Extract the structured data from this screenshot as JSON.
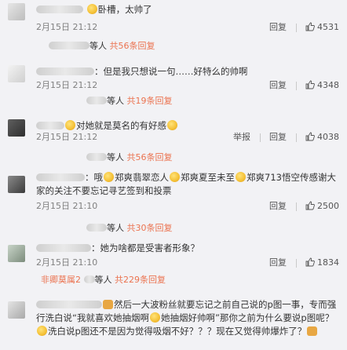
{
  "comments": [
    {
      "text": "卧槽，太帅了",
      "time": "2月15日 21:12",
      "reply_label": "回复",
      "likes": "4531",
      "reply_summary": {
        "prefix": "等人",
        "count_text": "共56条回复"
      }
    },
    {
      "text": "：但是我只想说一句……好特么的帅啊",
      "time": "2月15日 21:12",
      "reply_label": "回复",
      "likes": "4348",
      "reply_summary": {
        "prefix": "等人",
        "count_text": "共19条回复"
      }
    },
    {
      "text": "对她就是莫名的有好感",
      "time": "2月15日 21:12",
      "report_label": "举报",
      "reply_label": "回复",
      "likes": "4038",
      "reply_summary": {
        "prefix": "等人",
        "count_text": "共56条回复"
      }
    },
    {
      "text_parts": [
        "：哦",
        "郑爽翡翠恋人",
        "郑爽夏至未至",
        "郑爽713悟空传感谢大家的关注不要忘记寻艺签到和投票"
      ],
      "time": "2月15日 21:10",
      "reply_label": "回复",
      "likes": "2500",
      "reply_summary": {
        "prefix": "等人",
        "count_text": "共30条回复"
      }
    },
    {
      "text": "：她为啥都是受害者形象？",
      "time": "2月15日 21:10",
      "reply_label": "回复",
      "likes": "1834",
      "reply_summary": {
        "name": "非卿莫属2",
        "prefix": "等人",
        "count_text": "共229条回复"
      }
    },
    {
      "text_parts": [
        "然后一大波粉丝就要忘记之前自己说的p图一事，专而强行洗白说“我就喜欢她抽烟啊",
        "她抽烟好帅啊”那你之前为什么要说p图呢？",
        "洗白说p图还不是因为觉得吸烟不好？？？现在又觉得帅爆炸了？"
      ]
    }
  ],
  "colors": {
    "accent": "#eb7350",
    "background": "#f2f2f5"
  },
  "icons": {
    "like": "thumb-up-icon",
    "emoji": "smiley-emoji-icon"
  }
}
